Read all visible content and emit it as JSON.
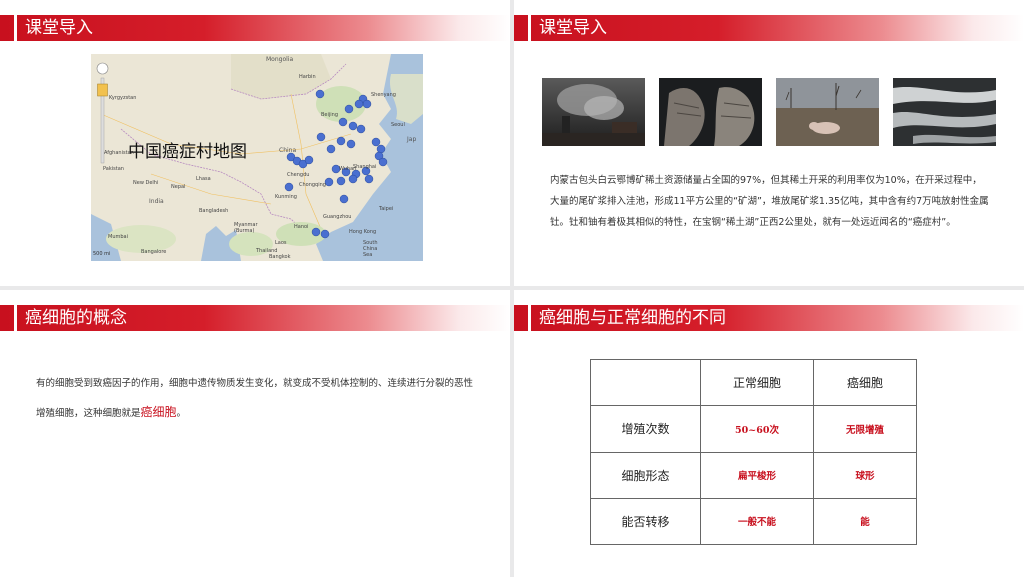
{
  "slide1": {
    "title": "课堂导入",
    "map_title": "中国癌症村地图",
    "labels": {
      "mongolia": "Mongolia",
      "kyrgyzstan": "Kyrgyzstan",
      "china": "China",
      "afghanistan": "Afghanistan",
      "pakistan": "Pakistan",
      "new_delhi": "New Delhi",
      "nepal": "Nepal",
      "india": "India",
      "bangladesh": "Bangladesh",
      "myanmar": "Myanmar\n(Burma)",
      "mumbai": "Mumbai",
      "bangalore": "Bangalore",
      "laos": "Laos",
      "thailand": "Thailand",
      "bangkok": "Bangkok",
      "harbin": "Harbin",
      "beijing": "Beijing",
      "seoul": "Seoul",
      "shanghai": "Shanghai",
      "wuhan": "Wuhan",
      "chengdu": "Chengdu",
      "chongqing": "Chongqing",
      "guangzhou": "Guangzhou",
      "hong_kong": "Hong Kong",
      "taipei": "Taipei",
      "hanoi": "Hanoi",
      "kunming": "Kunming",
      "lhasa": "Lhasa",
      "shenyang": "Shenyang",
      "japan": "Jap",
      "south_china_sea": "South\nChina\nSea"
    },
    "scale": "500 mi"
  },
  "slide2": {
    "title": "课堂导入",
    "paragraph": "内蒙古包头白云鄂博矿稀土资源储量占全国的97%，但其稀土开采的利用率仅为10%，在开采过程中，大量的尾矿浆排入洼池，形成11平方公里的“矿湖”，堆放尾矿浆1.35亿吨，其中含有约7万吨放射性金属钍。钍和铀有着极其相似的特性，在宝钢“稀土湖”正西2公里处，就有一处远近闻名的“癌症村”。"
  },
  "slide3": {
    "title": "癌细胞的概念",
    "paragraph_before": "有的细胞受到致癌因子的作用，细胞中遗传物质发生变化，就变成不受机体控制的、连续进行分裂的恶性增殖细胞，这种细胞就是",
    "highlight": "癌细胞",
    "paragraph_after": "。"
  },
  "slide4": {
    "title": "癌细胞与正常细胞的不同",
    "table": {
      "headers": [
        "",
        "正常细胞",
        "癌细胞"
      ],
      "rows": [
        [
          "增殖次数",
          "50~60次",
          "无限增殖"
        ],
        [
          "细胞形态",
          "扁平梭形",
          "球形"
        ],
        [
          "能否转移",
          "一般不能",
          "能"
        ]
      ]
    }
  },
  "colors": {
    "accent": "#c8101e",
    "bar_fade": "#ffffff"
  }
}
